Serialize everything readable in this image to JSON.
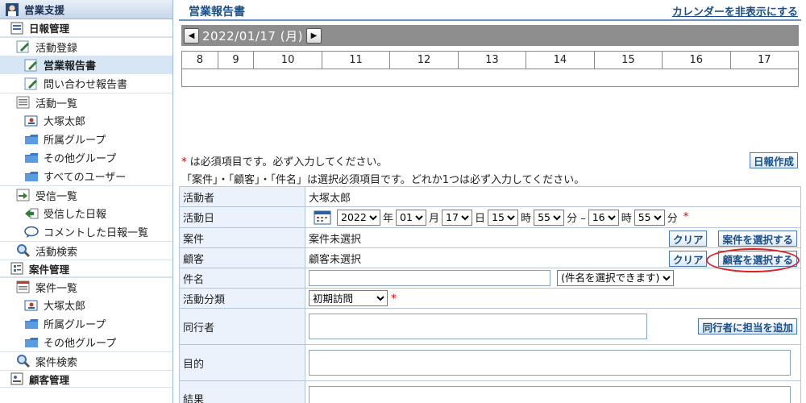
{
  "sidebar": {
    "section_title": "営業支援",
    "daily_group": "日報管理",
    "activity_register": "活動登録",
    "sales_report": "営業報告書",
    "inquiry_report": "問い合わせ報告書",
    "activity_list": "活動一覧",
    "user_self": "大塚太郎",
    "group_own": "所属グループ",
    "group_other": "その他グループ",
    "all_users": "すべてのユーザー",
    "received_list": "受信一覧",
    "received_reports": "受信した日報",
    "commented_reports": "コメントした日報一覧",
    "activity_search": "活動検索",
    "case_group": "案件管理",
    "case_list": "案件一覧",
    "case_user": "大塚太郎",
    "case_group_own": "所属グループ",
    "case_group_other": "その他グループ",
    "case_search": "案件検索",
    "customer_group": "顧客管理"
  },
  "header": {
    "title": "営業報告書",
    "hide_calendar": "カレンダーを非表示にする"
  },
  "date_nav": {
    "prev": "◀",
    "next": "▶",
    "date": "2022/01/17 (月)"
  },
  "timeline_hours": [
    "8",
    "9",
    "10",
    "11",
    "12",
    "13",
    "14",
    "15",
    "16",
    "17"
  ],
  "notes": {
    "required_star": "*",
    "required_text": "は必須項目です。必ず入力してください。",
    "select_required": "「案件」・「顧客」・「件名」は選択必須項目です。どれか1つは必ず入力してください。"
  },
  "buttons": {
    "create_report": "日報作成",
    "clear": "クリア",
    "select_case": "案件を選択する",
    "select_customer": "顧客を選択する",
    "add_companion": "同行者に担当を追加"
  },
  "form": {
    "actor_label": "活動者",
    "actor_value": "大塚太郎",
    "date_label": "活動日",
    "year": "2022",
    "year_unit": "年",
    "month": "01",
    "month_unit": "月",
    "day": "17",
    "day_unit": "日",
    "start_hour": "15",
    "hour_unit": "時",
    "start_min": "55",
    "min_unit_dash": "分 –",
    "end_hour": "16",
    "end_hour_unit": "時",
    "end_min": "55",
    "min_unit": "分",
    "case_label": "案件",
    "case_value": "案件未選択",
    "customer_label": "顧客",
    "customer_value": "顧客未選択",
    "subject_label": "件名",
    "subject_select": "(件名を選択できます)",
    "category_label": "活動分類",
    "category_value": "初期訪問",
    "companion_label": "同行者",
    "purpose_label": "目的",
    "result_label": "結果"
  },
  "colors": {
    "accent": "#1b4f87",
    "required": "#d00000",
    "date_bar": "#8d8d8d",
    "highlight_circle": "#dd2222"
  }
}
